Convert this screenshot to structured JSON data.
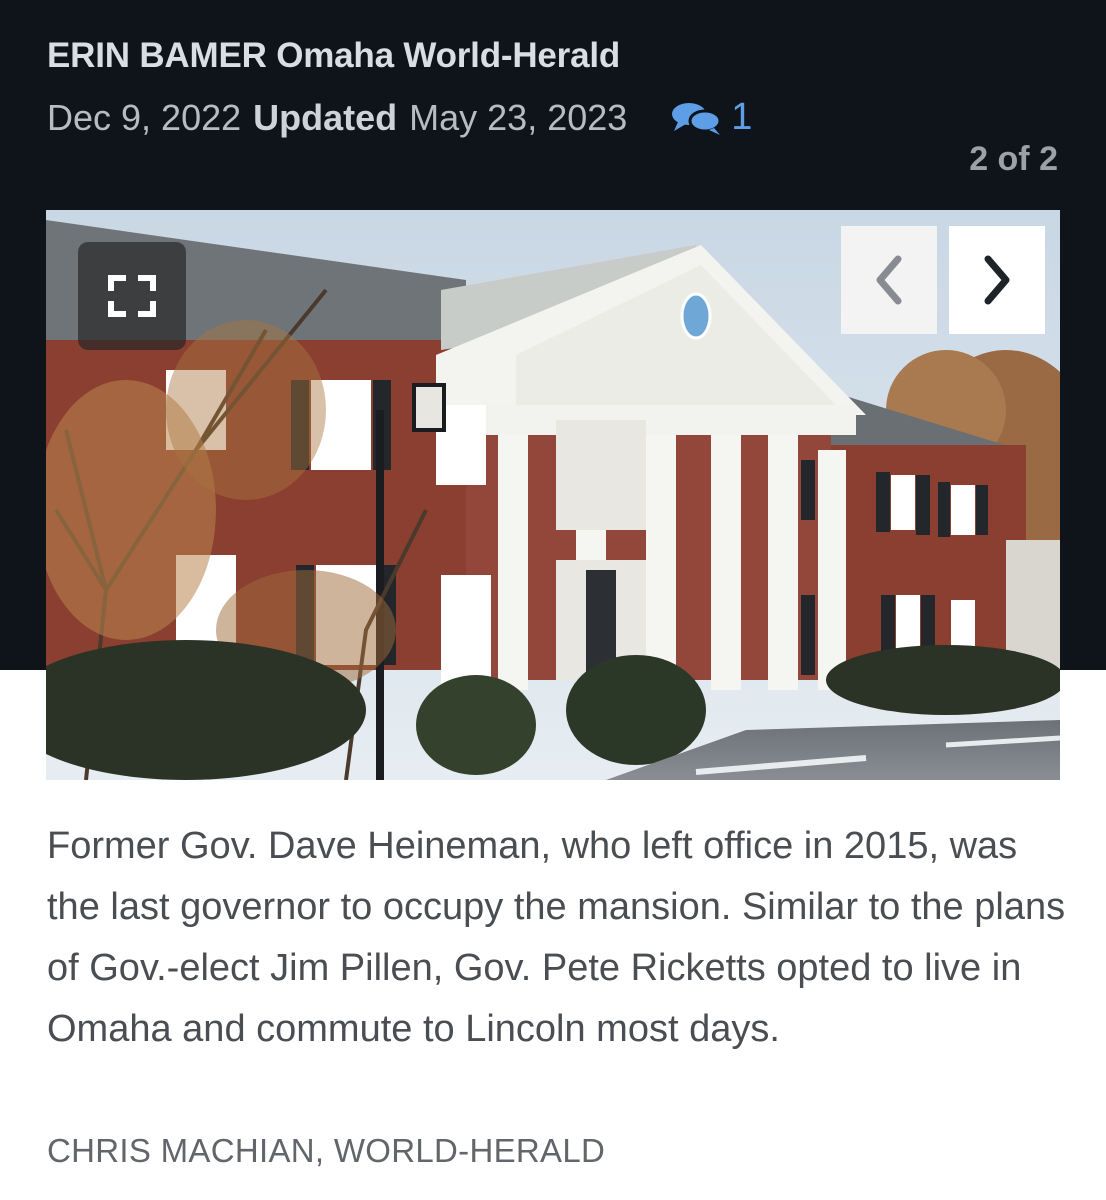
{
  "article": {
    "byline": "ERIN BAMER Omaha World-Herald",
    "published": "Dec 9, 2022",
    "updated_label": "Updated",
    "updated": "May 23, 2023",
    "comment_count": "1",
    "comment_icon": "comments-icon"
  },
  "gallery": {
    "counter": "2 of 2",
    "current_index": 2,
    "total": 2,
    "photo_subject": "Governor's mansion",
    "fullscreen_icon": "expand-icon",
    "prev_icon": "chevron-left-icon",
    "next_icon": "chevron-right-icon",
    "caption": "Former Gov. Dave Heineman, who left office in 2015, was the last governor to occupy the mansion. Similar to the plans of Gov.-elect Jim Pillen, Gov. Pete Ricketts opted to live in Omaha and commute to Lincoln most days.",
    "credit": "CHRIS MACHIAN, WORLD-HERALD"
  },
  "colors": {
    "header_bg": "#0f141b",
    "accent": "#5e9ee6",
    "brick": "#8a3f30"
  }
}
